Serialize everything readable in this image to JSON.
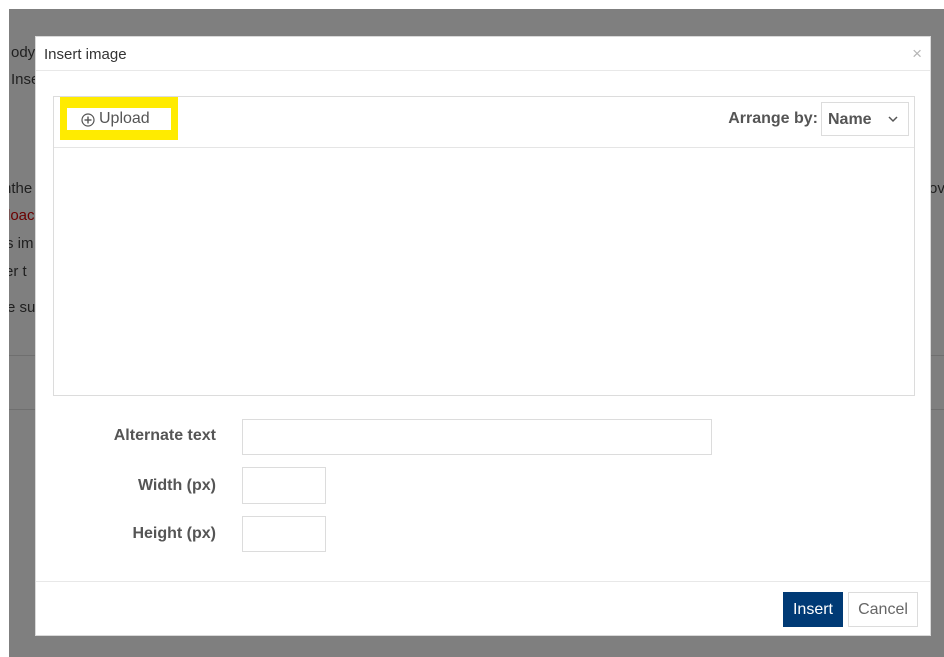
{
  "background": {
    "fragments": [
      {
        "text": "ody"
      },
      {
        "text": "Inse"
      },
      {
        "text": "nthe"
      },
      {
        "text": "loac"
      },
      {
        "text": "s im"
      },
      {
        "text": "er t"
      },
      {
        "text": "e su"
      },
      {
        "text": "ov"
      }
    ]
  },
  "dialog": {
    "title": "Insert image",
    "close_glyph": "×",
    "toolbar": {
      "upload_label": "Upload",
      "upload_icon": "plus-circle-icon",
      "highlight_color": "#ffeb00",
      "arrange_label": "Arrange by:",
      "sort_value": "Name",
      "sort_icon": "chevron-down-icon"
    },
    "form": {
      "alt_label": "Alternate text",
      "alt_value": "",
      "width_label": "Width (px)",
      "width_value": "",
      "height_label": "Height (px)",
      "height_value": ""
    },
    "footer": {
      "insert_label": "Insert",
      "cancel_label": "Cancel",
      "insert_color": "#003a75"
    }
  }
}
